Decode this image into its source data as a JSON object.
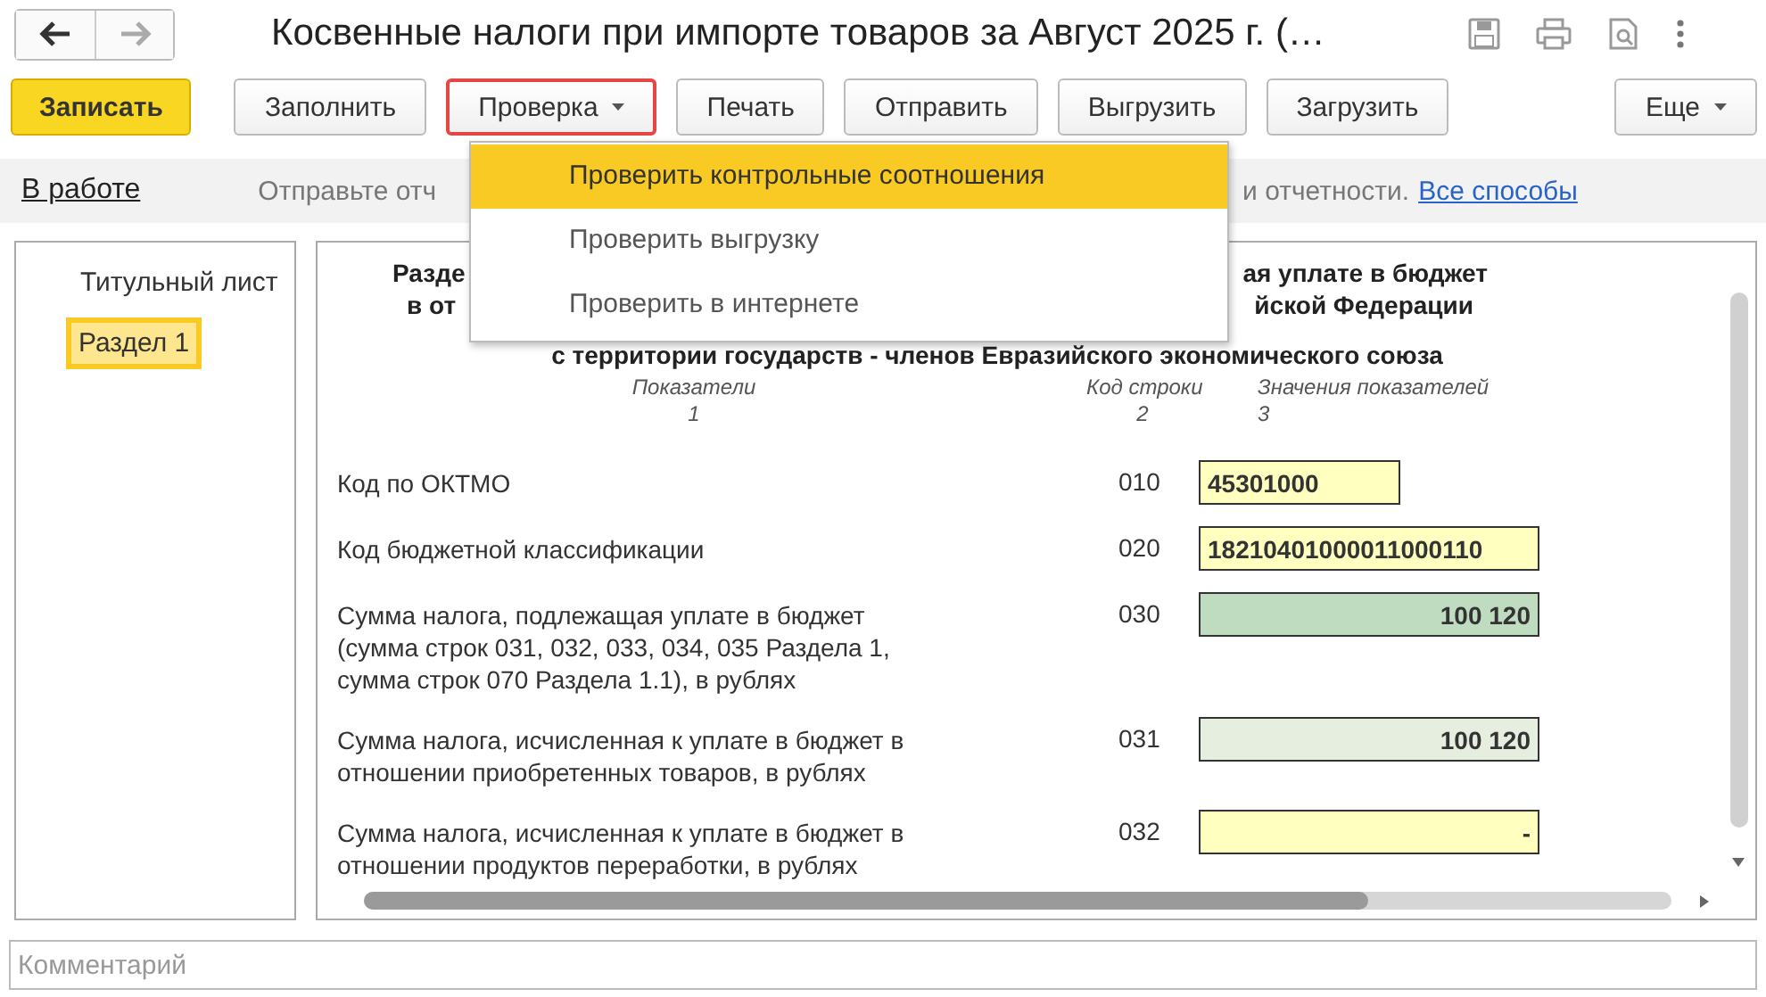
{
  "window": {
    "title": "Косвенные налоги при импорте товаров за Август 2025 г. (…"
  },
  "toolbar": {
    "buttons": [
      {
        "label": "Записать",
        "kind": "primary",
        "open": false
      },
      {
        "label": "Заполнить",
        "kind": "plain",
        "open": false
      },
      {
        "label": "Проверка",
        "kind": "dropdown",
        "open": true
      },
      {
        "label": "Печать",
        "kind": "plain",
        "open": false
      },
      {
        "label": "Отправить",
        "kind": "plain",
        "open": false
      },
      {
        "label": "Выгрузить",
        "kind": "plain",
        "open": false
      },
      {
        "label": "Загрузить",
        "kind": "plain",
        "open": false
      }
    ],
    "more": {
      "label": "Еще"
    }
  },
  "menu": {
    "items": [
      {
        "label": "Проверить контрольные соотношения",
        "highlighted": true
      },
      {
        "label": "Проверить выгрузку",
        "highlighted": false
      },
      {
        "label": "Проверить в интернете",
        "highlighted": false
      }
    ]
  },
  "info_bar": {
    "status": "В работе",
    "text_before": "Отправьте отч",
    "text_after": "и отчетности.",
    "link": "Все способы"
  },
  "sections": [
    {
      "label": "Титульный лист",
      "selected": false
    },
    {
      "label": "Раздел 1",
      "selected": true
    }
  ],
  "form": {
    "heading": [
      {
        "left": "Разде",
        "right": "ая уплате в бюджет"
      },
      {
        "left": "в от",
        "right": "йской Федерации"
      }
    ],
    "heading_last": "с территории государств - членов Евразийского экономического союза",
    "columns": [
      {
        "title": "Показатели",
        "number": "1"
      },
      {
        "title": "Код строки",
        "number": "2"
      },
      {
        "title": "Значения показателей",
        "number": "3"
      }
    ],
    "rows": [
      {
        "label": "Код по ОКТМО",
        "code": "010",
        "value": "45301000",
        "kind": "text"
      },
      {
        "label": "Код бюджетной классификации",
        "code": "020",
        "value": "18210401000011000110",
        "kind": "text"
      },
      {
        "label": "Сумма налога, подлежащая уплате в бюджет (сумма строк 031, 032, 033, 034, 035 Раздела 1, сумма строк 070 Раздела 1.1), в рублях",
        "code": "030",
        "value": "100 120",
        "kind": "total"
      },
      {
        "label": "Сумма налога, исчисленная к уплате в бюджет в отношении приобретенных товаров, в рублях",
        "code": "031",
        "value": "100 120",
        "kind": "subtotal"
      },
      {
        "label": "Сумма налога, исчисленная к уплате в бюджет в отношении продуктов переработки, в рублях",
        "code": "032",
        "value": "-",
        "kind": "amount"
      }
    ]
  },
  "comment": {
    "placeholder": "Комментарий"
  }
}
